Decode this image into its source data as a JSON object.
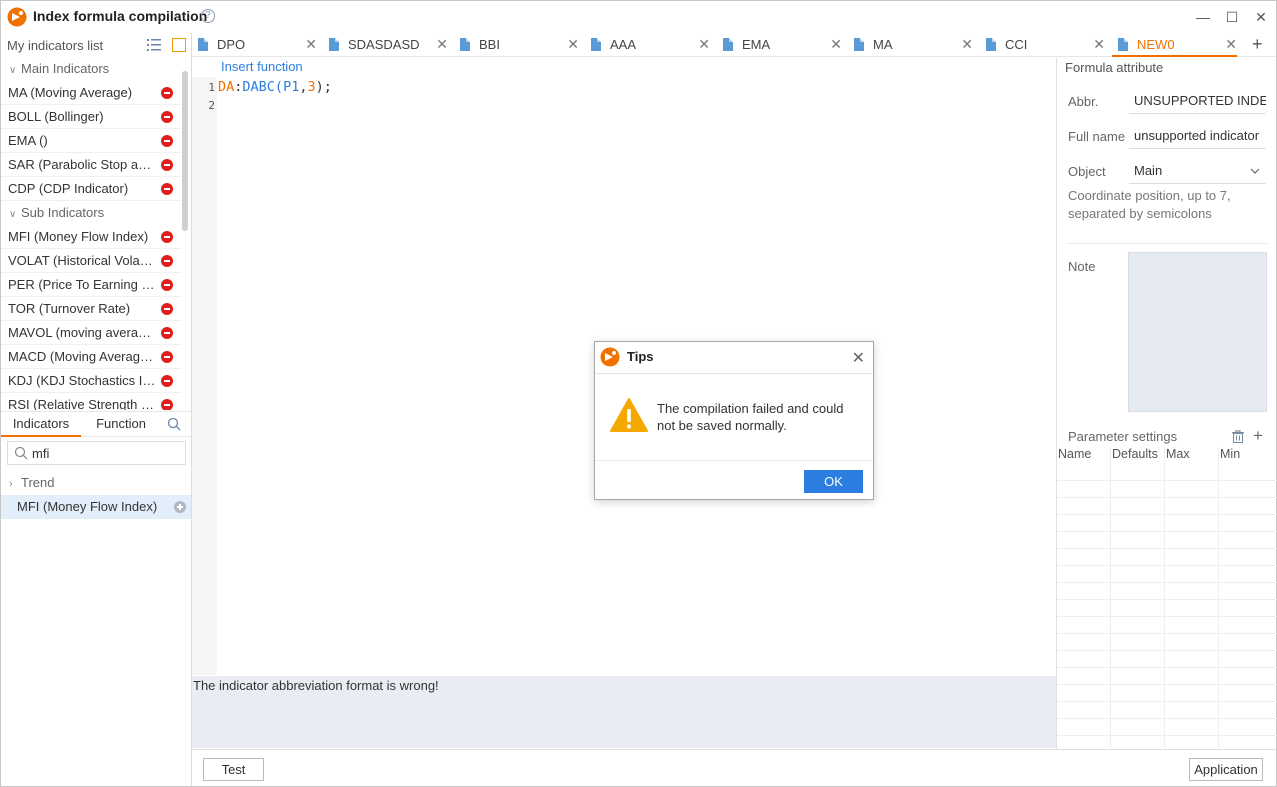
{
  "window": {
    "title": "Index formula compilation",
    "help": "?",
    "minimize": "—",
    "maximize": "☐",
    "close": "✕"
  },
  "left": {
    "header": "My indicators list",
    "groups": {
      "main": "Main Indicators",
      "sub": "Sub Indicators"
    },
    "main_items": [
      "MA (Moving Average)",
      "BOLL (Bollinger)",
      "EMA ()",
      "SAR (Parabolic Stop and Reverse)",
      "CDP (CDP Indicator)"
    ],
    "sub_items": [
      "MFI (Money Flow Index)",
      "VOLAT (Historical Volatility)",
      "PER (Price To Earning Ratio)",
      "TOR (Turnover Rate)",
      "MAVOL (moving average volume)",
      "MACD (Moving Average Convergence)",
      "KDJ (KDJ Stochastics Indicator)",
      "RSI (Relative Strength Index)"
    ],
    "tabs": {
      "indicators": "Indicators",
      "function": "Function"
    },
    "search": {
      "value": "mfi"
    },
    "trend": "Trend",
    "result": "MFI (Money Flow Index)"
  },
  "tabs": [
    {
      "name": "DPO"
    },
    {
      "name": "SDASDASD"
    },
    {
      "name": "BBI"
    },
    {
      "name": "AAA"
    },
    {
      "name": "EMA"
    },
    {
      "name": "MA"
    },
    {
      "name": "CCI"
    },
    {
      "name": "NEW0"
    }
  ],
  "tab_close": "✕",
  "tab_add": "+",
  "editor": {
    "insert_function": "Insert function",
    "line_numbers": [
      "1",
      "2"
    ],
    "code": {
      "id": "DA",
      "colon": ":",
      "fn": "DABC",
      "open": "(",
      "p": "P1",
      "comma": ",",
      "num": "3",
      "close": ");"
    }
  },
  "output": {
    "message": "The indicator abbreviation format is wrong!"
  },
  "buttons": {
    "test": "Test",
    "application": "Application"
  },
  "attributes": {
    "title": "Formula attribute",
    "abbr_label": "Abbr.",
    "abbr_value": "UNSUPPORTED INDEX",
    "fullname_label": "Full name",
    "fullname_value": "unsupported indicator",
    "object_label": "Object",
    "object_value": "Main",
    "coord_hint": "Coordinate position, up to 7, separated by semicolons",
    "note_label": "Note",
    "param_title": "Parameter settings",
    "param_cols": [
      "Name",
      "Defaults",
      "Max",
      "Min"
    ]
  },
  "dialog": {
    "title": "Tips",
    "close": "✕",
    "message": "The compilation failed and could not be saved normally.",
    "ok": "OK"
  },
  "colors": {
    "accent": "#f07000",
    "link": "#2b7de0",
    "delete": "#e02020",
    "selected_row": "#e3eefb",
    "output_bg": "#e9edf3"
  }
}
